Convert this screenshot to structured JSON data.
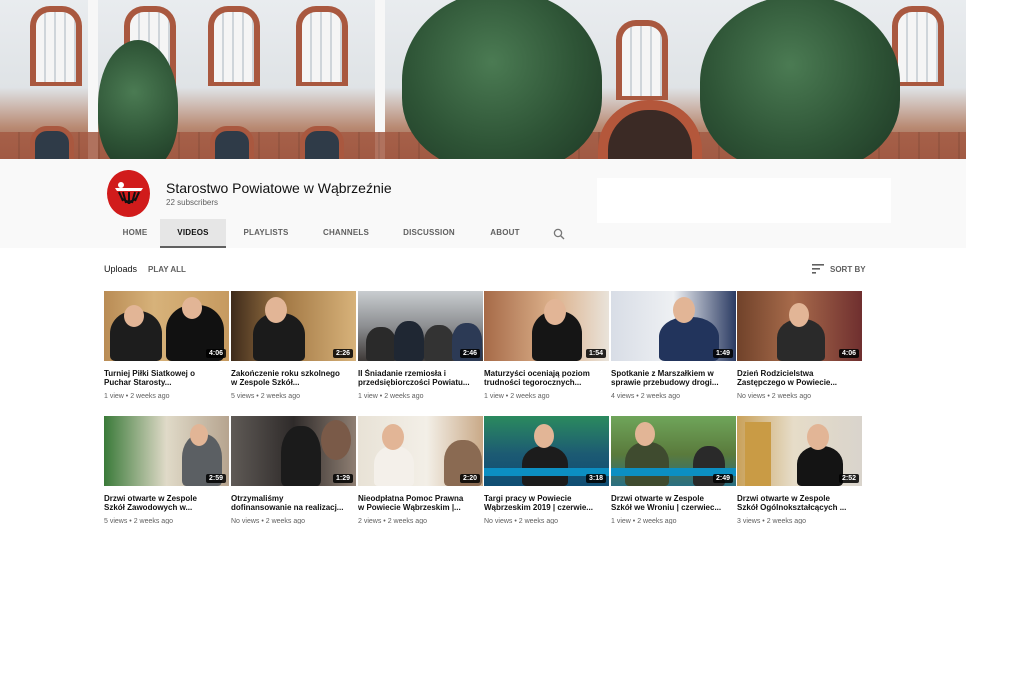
{
  "channel": {
    "name": "Starostwo Powiatowe w Wąbrzeźnie",
    "subscribers": "22 subscribers"
  },
  "tabs": [
    {
      "label": "HOME",
      "active": false
    },
    {
      "label": "VIDEOS",
      "active": true
    },
    {
      "label": "PLAYLISTS",
      "active": false
    },
    {
      "label": "CHANNELS",
      "active": false
    },
    {
      "label": "DISCUSSION",
      "active": false
    },
    {
      "label": "ABOUT",
      "active": false
    }
  ],
  "icons": {
    "search": "search-icon",
    "sort": "sort-icon",
    "avatar": "channel-logo"
  },
  "section": {
    "title": "Uploads",
    "play_all": "PLAY ALL",
    "sort_by": "SORT BY"
  },
  "colors": {
    "active_tab_underline": "#606060",
    "logo_red": "#d11b1b"
  },
  "videos": [
    {
      "title_line1": "Turniej Piłki Siatkowej o",
      "title_line2": "Puchar Starosty...",
      "duration": "4:06",
      "views": "1 view",
      "age": "2 weeks ago"
    },
    {
      "title_line1": "Zakończenie roku szkolnego",
      "title_line2": "w Zespole Szkół...",
      "duration": "2:26",
      "views": "5 views",
      "age": "2 weeks ago"
    },
    {
      "title_line1": "II Śniadanie rzemiosła i",
      "title_line2": "przedsiębiorczości Powiatu...",
      "duration": "2:46",
      "views": "1 view",
      "age": "2 weeks ago"
    },
    {
      "title_line1": "Maturzyści oceniają poziom",
      "title_line2": "trudności tegorocznych...",
      "duration": "1:54",
      "views": "1 view",
      "age": "2 weeks ago"
    },
    {
      "title_line1": "Spotkanie z Marszałkiem w",
      "title_line2": "sprawie przebudowy drogi...",
      "duration": "1:49",
      "views": "4 views",
      "age": "2 weeks ago"
    },
    {
      "title_line1": "Dzień Rodzicielstwa",
      "title_line2": "Zastępczego w Powiecie...",
      "duration": "4:06",
      "views": "No views",
      "age": "2 weeks ago"
    },
    {
      "title_line1": "Drzwi otwarte w Zespole",
      "title_line2": "Szkół Zawodowych w...",
      "duration": "2:59",
      "views": "5 views",
      "age": "2 weeks ago"
    },
    {
      "title_line1": "Otrzymaliśmy",
      "title_line2": "dofinansowanie na realizacj...",
      "duration": "1:29",
      "views": "No views",
      "age": "2 weeks ago"
    },
    {
      "title_line1": "Nieodpłatna Pomoc Prawna",
      "title_line2": "w Powiecie Wąbrzeskim |...",
      "duration": "2:20",
      "views": "2 views",
      "age": "2 weeks ago"
    },
    {
      "title_line1": "Targi pracy w Powiecie",
      "title_line2": "Wąbrzeskim 2019 | czerwie...",
      "duration": "3:18",
      "views": "No views",
      "age": "2 weeks ago"
    },
    {
      "title_line1": "Drzwi otwarte w Zespole",
      "title_line2": "Szkół we Wroniu | czerwiec...",
      "duration": "2:49",
      "views": "1 view",
      "age": "2 weeks ago"
    },
    {
      "title_line1": "Drzwi otwarte w Zespole",
      "title_line2": "Szkół Ogólnokształcących ...",
      "duration": "2:52",
      "views": "3 views",
      "age": "2 weeks ago"
    }
  ]
}
